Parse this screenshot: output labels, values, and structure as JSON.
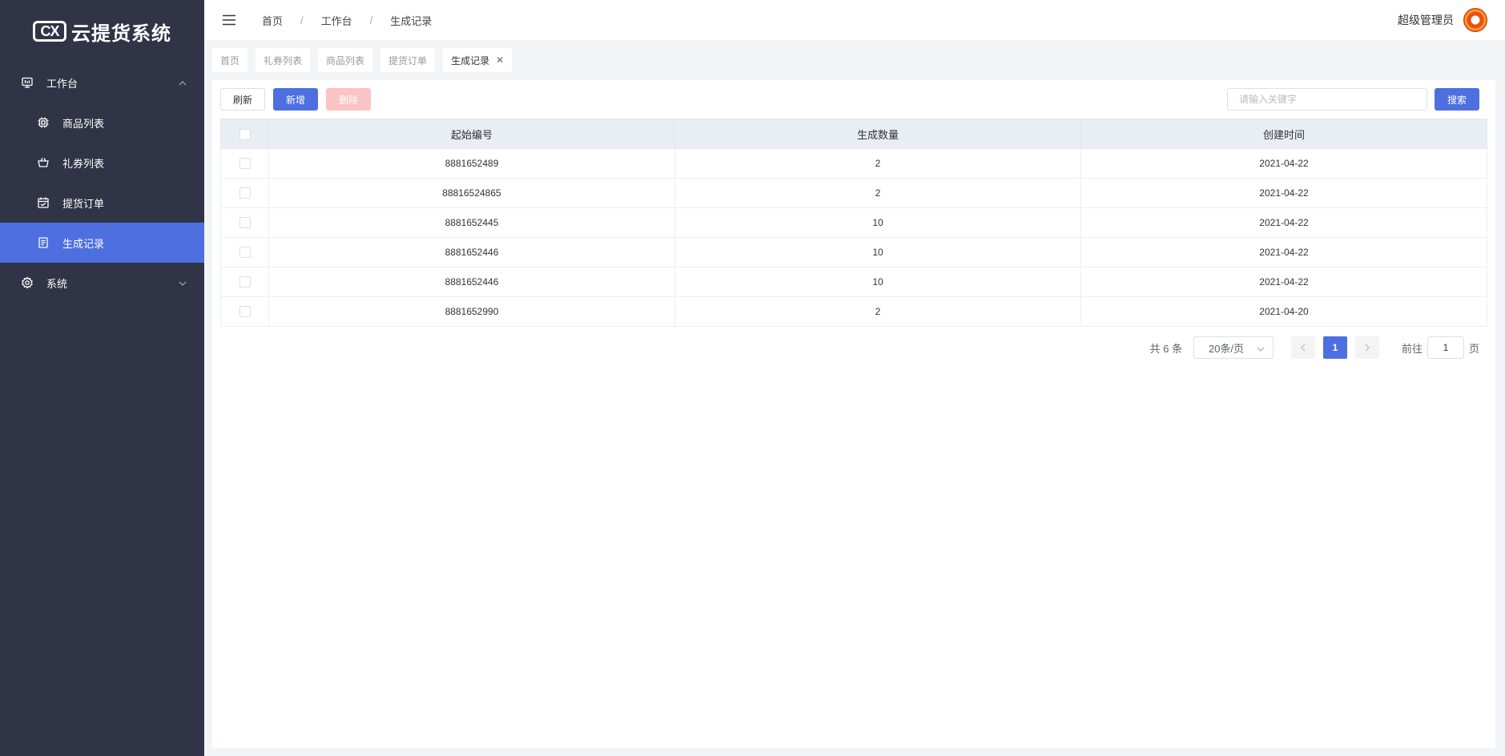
{
  "app": {
    "logo_mark": "CX",
    "logo_text": "云提货系统"
  },
  "sidebar": {
    "groups": [
      {
        "label": "工作台",
        "icon": "monitor-icon",
        "expanded": true,
        "items": [
          {
            "label": "商品列表",
            "icon": "chip-icon"
          },
          {
            "label": "礼券列表",
            "icon": "basket-icon"
          },
          {
            "label": "提货订单",
            "icon": "calendar-icon"
          },
          {
            "label": "生成记录",
            "icon": "document-icon",
            "active": true
          }
        ]
      },
      {
        "label": "系统",
        "icon": "gear-icon",
        "expanded": false
      }
    ]
  },
  "header": {
    "breadcrumb": [
      "首页",
      "工作台",
      "生成记录"
    ],
    "separator": "/",
    "user_name": "超级管理员"
  },
  "tabs": [
    {
      "label": "首页"
    },
    {
      "label": "礼券列表"
    },
    {
      "label": "商品列表"
    },
    {
      "label": "提货订单"
    },
    {
      "label": "生成记录",
      "active": true,
      "closable": true
    }
  ],
  "toolbar": {
    "refresh_label": "刷新",
    "add_label": "新增",
    "delete_label": "删除",
    "search_placeholder": "请输入关键字",
    "search_label": "搜索"
  },
  "table": {
    "columns": [
      "起始编号",
      "生成数量",
      "创建时间"
    ],
    "rows": [
      {
        "start": "8881652489",
        "qty": "2",
        "created": "2021-04-22"
      },
      {
        "start": "88816524865",
        "qty": "2",
        "created": "2021-04-22"
      },
      {
        "start": "8881652445",
        "qty": "10",
        "created": "2021-04-22"
      },
      {
        "start": "8881652446",
        "qty": "10",
        "created": "2021-04-22"
      },
      {
        "start": "8881652446",
        "qty": "10",
        "created": "2021-04-22"
      },
      {
        "start": "8881652990",
        "qty": "2",
        "created": "2021-04-20"
      }
    ]
  },
  "pagination": {
    "total_text": "共 6 条",
    "page_size": "20条/页",
    "current_page": "1",
    "goto_label": "前往",
    "goto_value": "1",
    "page_suffix": "页"
  },
  "colors": {
    "sidebar_bg": "#303446",
    "accent": "#4d6fe0",
    "danger_disabled": "#f9c4c4"
  }
}
